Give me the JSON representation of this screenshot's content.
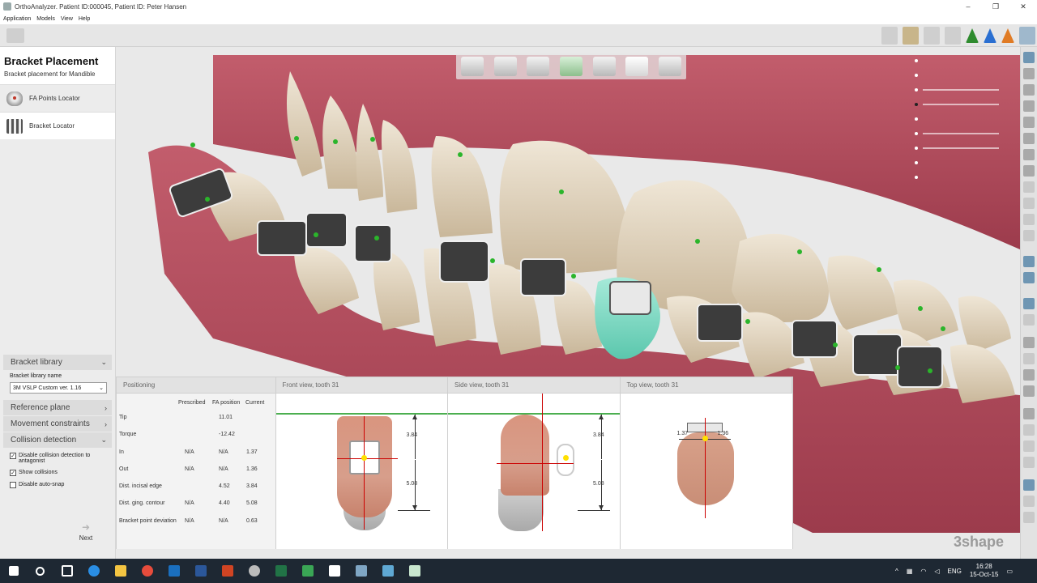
{
  "window": {
    "title": "OrthoAnalyzer. Patient ID:000045, Patient ID: Peter Hansen",
    "minimize": "–",
    "maximize": "❐",
    "close": "✕"
  },
  "menu": [
    "Application",
    "Models",
    "View",
    "Help"
  ],
  "left_panel": {
    "title": "Bracket Placement",
    "subtitle": "Bracket placement for Mandible",
    "steps": [
      {
        "label": "FA Points Locator",
        "icon": "fa-points-icon"
      },
      {
        "label": "Bracket Locator",
        "icon": "bracket-icon"
      }
    ],
    "bracket_library": {
      "header": "Bracket library",
      "name_label": "Bracket library name",
      "selected": "3M VSLP Custom ver. 1.16"
    },
    "sections": [
      "Reference plane",
      "Movement constraints"
    ],
    "collision": {
      "header": "Collision detection",
      "options": [
        {
          "label": "Disable collision detection to antagonist",
          "checked": true
        },
        {
          "label": "Show collisions",
          "checked": true
        },
        {
          "label": "Disable auto-snap",
          "checked": false
        }
      ]
    },
    "next_label": "Next"
  },
  "info_panel": {
    "headers": [
      "Positioning",
      "Front view, tooth 31",
      "Side view, tooth 31",
      "Top view, tooth 31"
    ],
    "columns": [
      "Prescribed",
      "FA position",
      "Current"
    ],
    "rows": [
      {
        "label": "Tip",
        "prescribed": "",
        "fa": "11.01",
        "current": ""
      },
      {
        "label": "Torque",
        "prescribed": "",
        "fa": "-12.42",
        "current": ""
      },
      {
        "label": "In",
        "prescribed": "N/A",
        "fa": "N/A",
        "current": "1.37"
      },
      {
        "label": "Out",
        "prescribed": "N/A",
        "fa": "N/A",
        "current": "1.36"
      },
      {
        "label": "Dist. incisal edge",
        "prescribed": "",
        "fa": "4.52",
        "current": "3.84"
      },
      {
        "label": "Dist. ging. contour",
        "prescribed": "N/A",
        "fa": "4.40",
        "current": "5.08"
      },
      {
        "label": "Bracket point deviation",
        "prescribed": "N/A",
        "fa": "N/A",
        "current": "0.63"
      }
    ],
    "front": {
      "upper": "3.84",
      "lower": "5.08"
    },
    "side": {
      "upper": "3.84",
      "lower": "5.08"
    },
    "top": {
      "left": "1.37",
      "right": "1.36"
    }
  },
  "watermark": "3shape",
  "taskbar": {
    "lang": "ENG",
    "time": "16:28",
    "date": "15-Oct-15"
  },
  "colors": {
    "gum": "#b54a5c",
    "tooth": "#e0d3be",
    "fa_point": "#2bb52b",
    "selected_tooth": "#7fd6c2",
    "taskbar": "#1e2833"
  }
}
